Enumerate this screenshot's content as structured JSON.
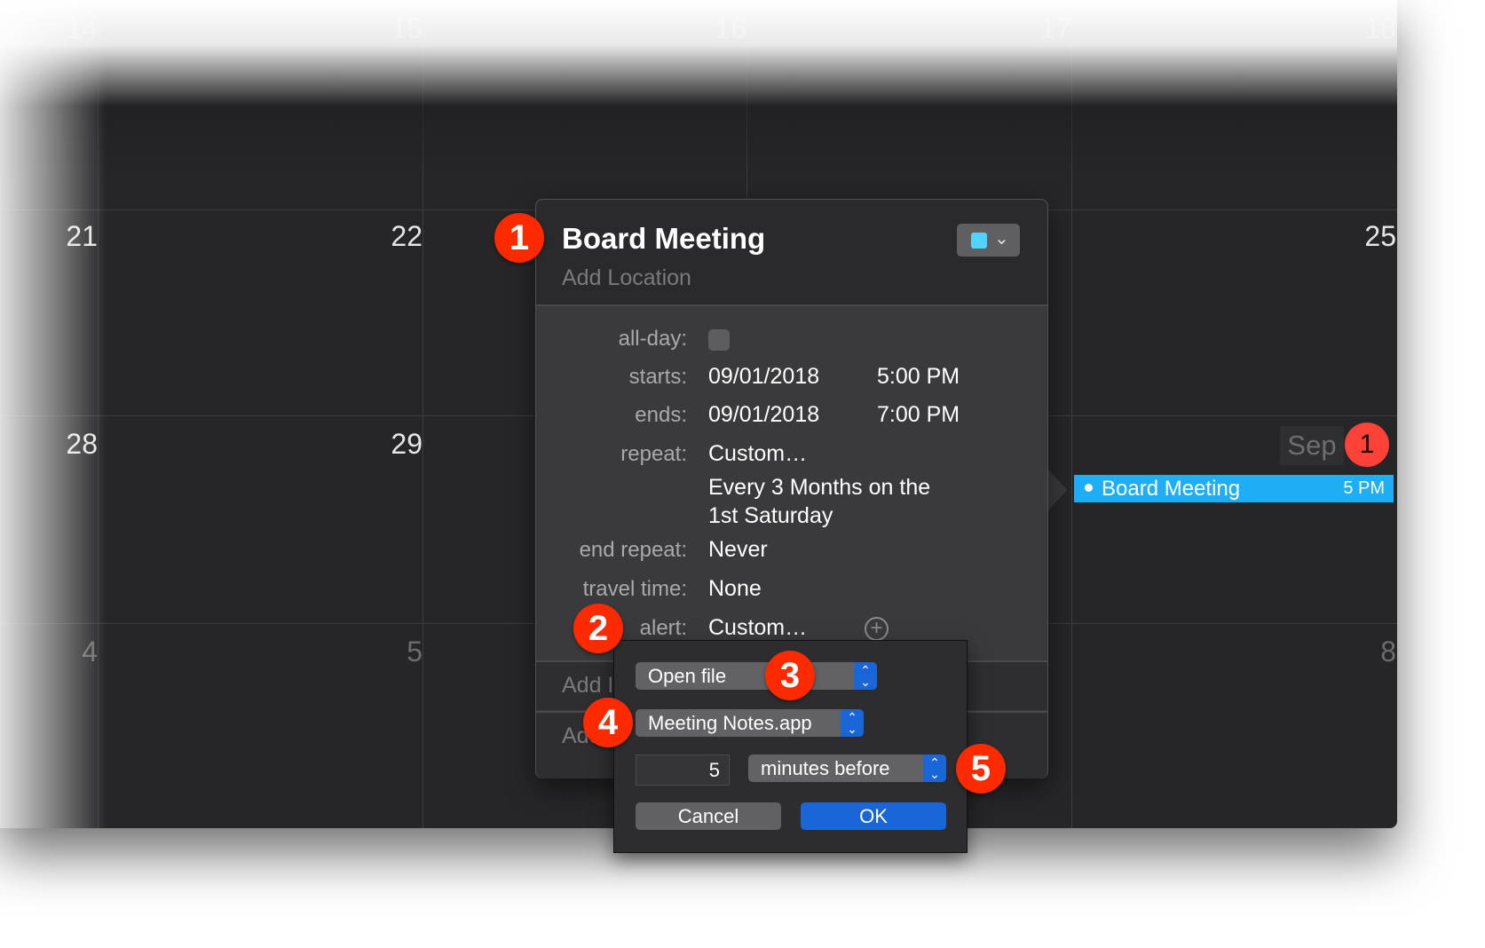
{
  "calendar": {
    "rows": [
      {
        "days": [
          "14",
          "15",
          "16",
          "17",
          "18"
        ],
        "dim": true
      },
      {
        "days": [
          "21",
          "22",
          "",
          "",
          "25"
        ],
        "dim": false
      },
      {
        "days": [
          "28",
          "29",
          "",
          "",
          ""
        ],
        "dim": false
      },
      {
        "days": [
          "4",
          "5",
          "",
          "",
          "8"
        ],
        "dim": true
      }
    ],
    "today_month": "Sep",
    "today_day": "1",
    "event": {
      "title": "Board Meeting",
      "time": "5 PM",
      "color": "#1eaef5"
    }
  },
  "popover": {
    "title": "Board Meeting",
    "location_placeholder": "Add Location",
    "calendar_color": "#52d3fb",
    "fields": {
      "allday_label": "all-day:",
      "starts_label": "starts:",
      "starts_date": "09/01/2018",
      "starts_time": "5:00 PM",
      "ends_label": "ends:",
      "ends_date": "09/01/2018",
      "ends_time": "7:00 PM",
      "repeat_label": "repeat:",
      "repeat_value": "Custom…",
      "repeat_desc_1": "Every 3 Months on the",
      "repeat_desc_2": "1st Saturday",
      "end_repeat_label": "end repeat:",
      "end_repeat_value": "Never",
      "travel_label": "travel time:",
      "travel_value": "None",
      "alert_label": "alert:",
      "alert_value": "Custom…"
    },
    "lower_1": "Add I",
    "lower_2": "Add"
  },
  "alert_dialog": {
    "action": "Open file",
    "file": "Meeting Notes.app",
    "amount": "5",
    "unit": "minutes before",
    "cancel": "Cancel",
    "ok": "OK"
  },
  "badges": [
    "1",
    "2",
    "3",
    "4",
    "5"
  ],
  "colors": {
    "badge": "#fd2a00",
    "accent": "#1a66d8",
    "today": "#fe4238"
  }
}
